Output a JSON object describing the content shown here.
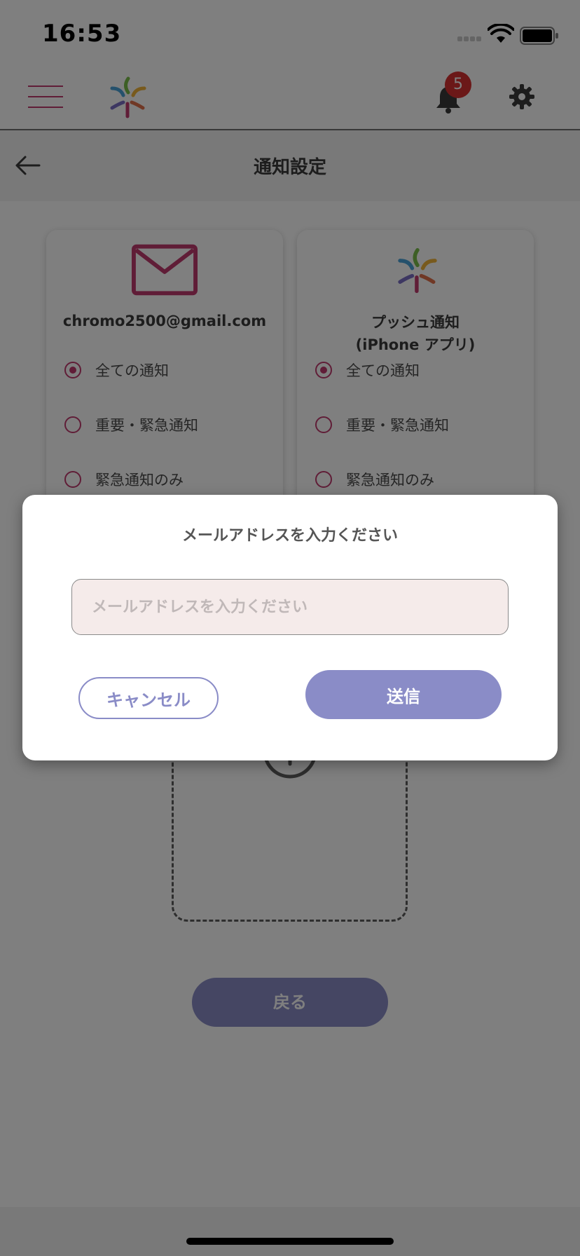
{
  "status_bar": {
    "time": "16:53"
  },
  "header": {
    "notification_count": "5"
  },
  "page": {
    "title": "通知設定",
    "back_label": "戻る"
  },
  "email_card": {
    "address": "chromo2500@gmail.com",
    "options": [
      {
        "label": "全ての通知",
        "selected": true
      },
      {
        "label": "重要・緊急通知",
        "selected": false
      },
      {
        "label": "緊急通知のみ",
        "selected": false
      }
    ]
  },
  "push_card": {
    "title_line1": "プッシュ通知",
    "title_line2": "(iPhone アプリ)",
    "options": [
      {
        "label": "全ての通知",
        "selected": true
      },
      {
        "label": "重要・緊急通知",
        "selected": false
      },
      {
        "label": "緊急通知のみ",
        "selected": false
      }
    ]
  },
  "dialog": {
    "title": "メールアドレスを入力ください",
    "input_placeholder": "メールアドレスを入力ください",
    "input_value": "",
    "cancel_label": "キャンセル",
    "send_label": "送信"
  },
  "colors": {
    "accent": "#c03a6e",
    "button": "#8a8cc7",
    "badge": "#d63031"
  },
  "icons": [
    "menu-icon",
    "logo-icon",
    "bell-icon",
    "gear-icon",
    "back-arrow-icon",
    "mail-icon",
    "add-circle-icon",
    "wifi-icon",
    "battery-icon"
  ]
}
